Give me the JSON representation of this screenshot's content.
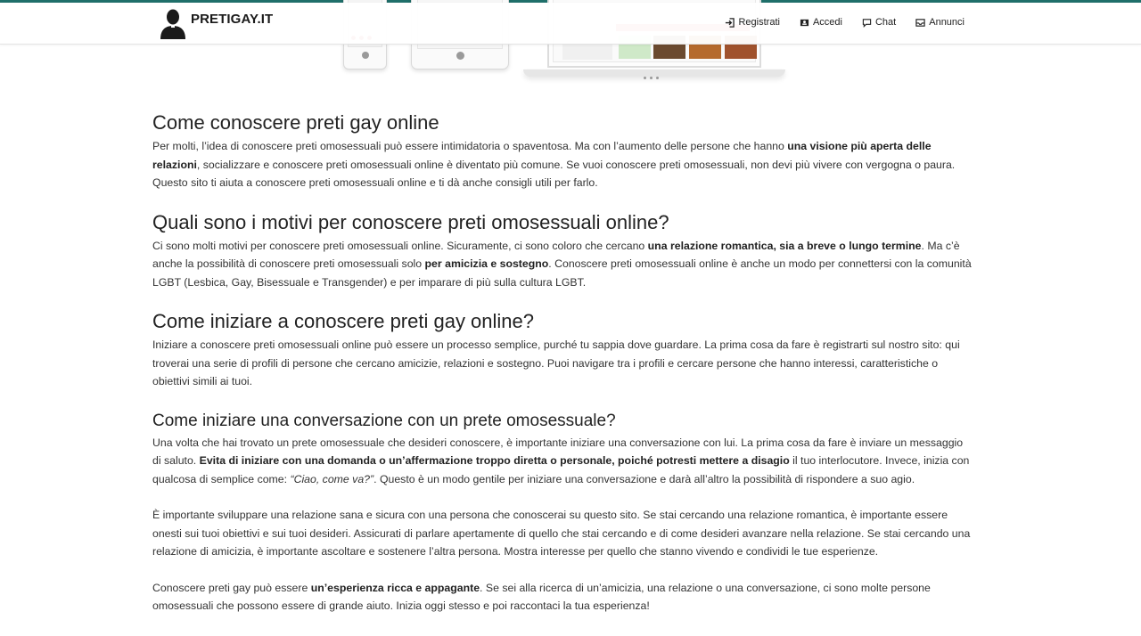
{
  "brand": {
    "logo_text": "PRETIGAY.IT",
    "accent_color": "#1f6f6a"
  },
  "nav": [
    {
      "label": "Registrati",
      "icon": "sign-in-icon"
    },
    {
      "label": "Accedi",
      "icon": "user-card-icon"
    },
    {
      "label": "Chat",
      "icon": "chat-bubble-icon"
    },
    {
      "label": "Annunci",
      "icon": "inbox-icon"
    }
  ],
  "sections": [
    {
      "title": "Come conoscere preti gay online",
      "paragraphs": [
        {
          "s1": "Per molti, l’idea di conoscere preti omosessuali può essere intimidatoria o spaventosa. Ma con l’aumento delle persone che hanno ",
          "b1": "una visione più aperta delle relazioni",
          "s2": ", socializzare e conoscere preti omosessuali online è diventato più comune. Se vuoi conoscere preti omosessuali, non devi più vivere con vergogna o paura. Questo sito ti aiuta a conoscere preti omosessuali online e ti dà anche consigli utili per farlo."
        }
      ]
    },
    {
      "title": "Quali sono i motivi per conoscere preti omosessuali online?",
      "paragraphs": [
        {
          "s1": "Ci sono molti motivi per conoscere preti omosessuali online. Sicuramente, ci sono coloro che cercano ",
          "b1": "una relazione romantica, sia a breve o lungo termine",
          "s2": ". Ma c’è anche la possibilità di conoscere preti omosessuali solo ",
          "b2": "per amicizia e sostegno",
          "s3": ". Conoscere preti omosessuali online è anche un modo per connettersi con la comunità LGBT (Lesbica, Gay, Bisessuale e Transgender) e per imparare di più sulla cultura LGBT."
        }
      ]
    },
    {
      "title": "Come iniziare a conoscere preti gay online?",
      "paragraphs": [
        {
          "s1": "Iniziare a conoscere preti omosessuali online può essere un processo semplice, purché tu sappia dove guardare. La prima cosa da fare è registrarti sul nostro sito: qui troverai una serie di profili di persone che cercano amicizie, relazioni e sostegno. Puoi navigare tra i profili e cercare persone che hanno interessi, caratteristiche o obiettivi simili ai tuoi."
        }
      ]
    },
    {
      "title": "Come iniziare una conversazione con un prete omosessuale?",
      "paragraphs": [
        {
          "s1": "Una volta che hai trovato un prete omosessuale che desideri conoscere, è importante iniziare una conversazione con lui. La prima cosa da fare è inviare un messaggio di saluto. ",
          "b1": "Evita di iniziare con una domanda o un’affermazione troppo diretta o personale, poiché potresti mettere a disagio",
          "s2": " il tuo interlocutore. Invece, inizia con qualcosa di semplice come: ",
          "i1": "“Ciao, come va?”",
          "s3": ". Questo è un modo gentile per iniziare una conversazione e darà all’altro la possibilità di rispondere a suo agio."
        },
        {
          "s1": "È importante sviluppare una relazione sana e sicura con una persona che conoscerai su questo sito. Se stai cercando una relazione romantica, è importante essere onesti sui tuoi obiettivi e sui tuoi desideri. Assicurati di parlare apertamente di quello che stai cercando e di come desideri avanzare nella relazione. Se stai cercando una relazione di amicizia, è importante ascoltare e sostenere l’altra persona. Mostra interesse per quello che stanno vivendo e condividi le tue esperienze."
        },
        {
          "s1": "Conoscere preti gay può essere ",
          "b1": "un’esperienza ricca e appagante",
          "s2": ". Se sei alla ricerca di un’amicizia, una relazione o una conversazione, ci sono molte persone omosessuali che possono essere di grande aiuto. Inizia oggi stesso e poi raccontaci la tua esperienza!"
        }
      ]
    }
  ]
}
